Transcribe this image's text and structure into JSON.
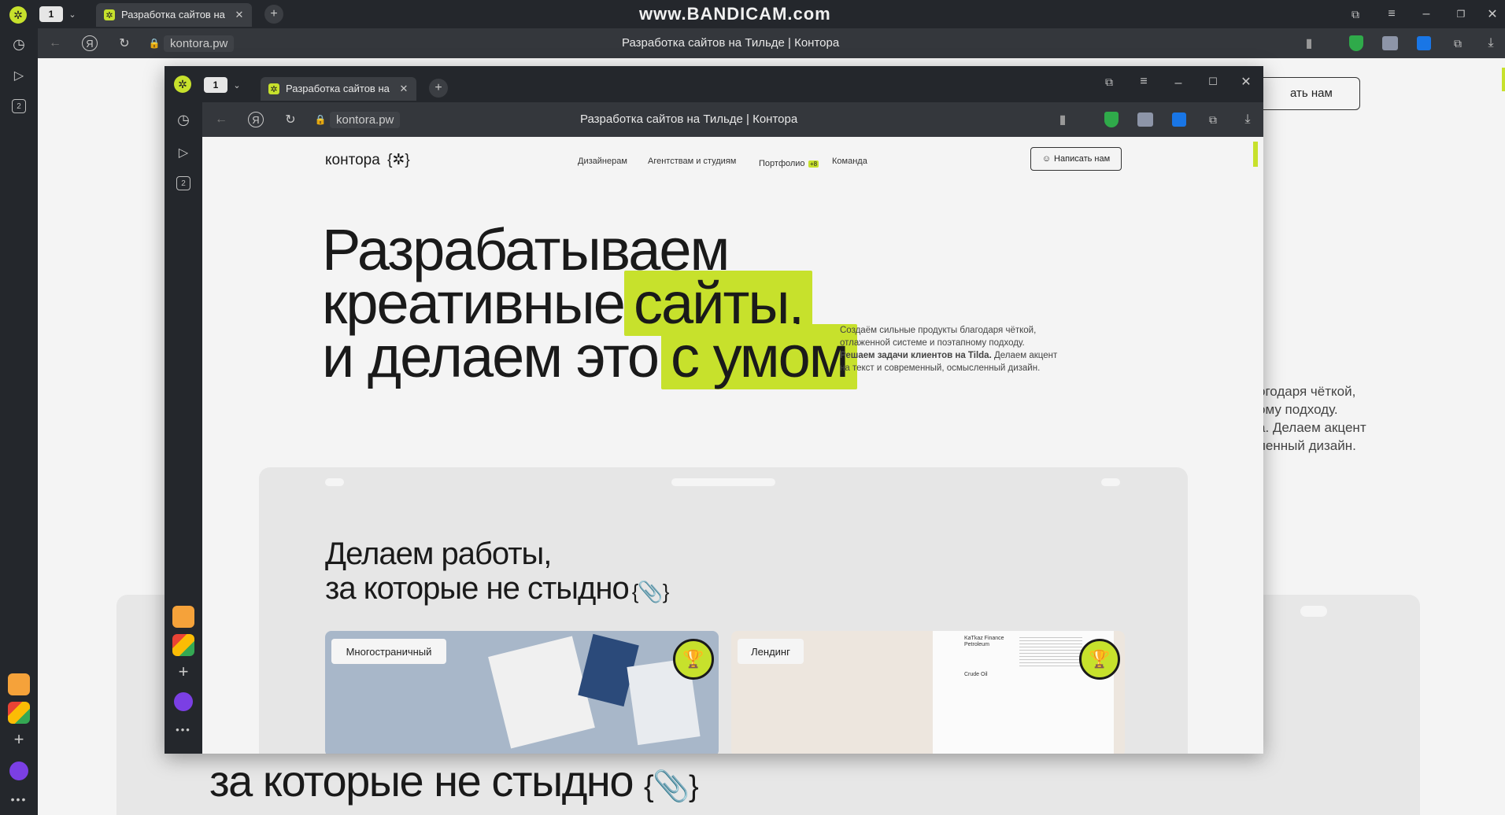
{
  "watermark": "www.BANDICAM.com",
  "outer": {
    "tab_count": "1",
    "tab_title": "Разработка сайтов на Т",
    "url": "kontora.pw",
    "page_title": "Разработка сайтов на Тильде | Контора",
    "sidebar_tabs_badge": "2",
    "page": {
      "button_fragment": "ать нам",
      "desc_lines": [
        "огодаря чёткой,",
        "ому подходу.",
        "a. Делаем акцент",
        "ленный дизайн."
      ],
      "heading_line2": "за которые не стыдно",
      "heading_symbol": "{📎}"
    }
  },
  "inner": {
    "tab_count": "1",
    "tab_title": "Разработка сайтов на Т",
    "url": "kontora.pw",
    "page_title": "Разработка сайтов на Тильде | Контора",
    "sidebar_tabs_badge": "2"
  },
  "site": {
    "logo_text": "контора",
    "logo_mark": "{✲}",
    "nav": [
      "Дизайнерам",
      "Агентствам и студиям",
      "Портфолио",
      "Команда"
    ],
    "portfolio_badge": "+8",
    "contact_button": "Написать нам",
    "hero": {
      "line1": "Разрабатываем",
      "line2_plain": "креативные",
      "line2_highlight": "сайты,",
      "line3_plain": "и делаем это",
      "line3_highlight": "с умом"
    },
    "description": {
      "line1": "Создаём сильные продукты благодаря чёткой,",
      "line2": "отлаженной системе и поэтапному подходу.",
      "line3_bold": "Решаем задачи клиентов на Tilda.",
      "line3_rest": " Делаем акцент",
      "line4": "на текст и современный, осмысленный дизайн."
    },
    "works_heading": {
      "line1": "Делаем работы,",
      "line2": "за которые не стыдно",
      "symbol": "{📎}"
    },
    "cards": [
      {
        "label": "Многостраничный"
      },
      {
        "label": "Лендинг",
        "doc_title": "KaTkaz Finance Petroleum",
        "doc_caption": "Crude Oil"
      }
    ]
  },
  "colors": {
    "accent": "#c7e12c",
    "chrome_dark": "#24272c",
    "address_bar": "#34373c",
    "page_bg": "#f4f4f4"
  },
  "icons": [
    "history-icon",
    "play-icon",
    "back-icon",
    "yandex-icon",
    "reload-icon",
    "lock-icon",
    "bookmark-icon",
    "shield-icon",
    "extension-icon",
    "download-icon",
    "add-tab-icon",
    "minimize-icon",
    "maximize-icon",
    "close-icon",
    "menu-icon",
    "mail-app-icon",
    "gmail-app-icon",
    "alice-icon",
    "more-icon",
    "trophy-icon"
  ]
}
